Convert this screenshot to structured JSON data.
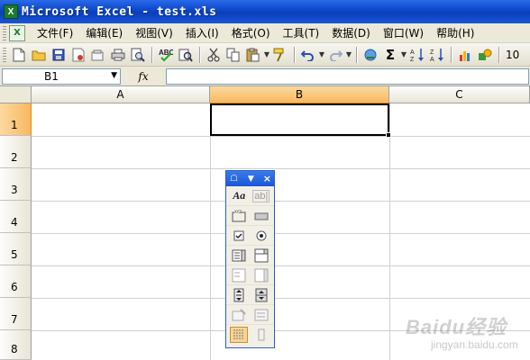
{
  "window": {
    "title": "Microsoft Excel - test.xls",
    "app_icon": "excel-icon"
  },
  "menu": {
    "items": [
      "文件(F)",
      "编辑(E)",
      "视图(V)",
      "插入(I)",
      "格式(O)",
      "工具(T)",
      "数据(D)",
      "窗口(W)",
      "帮助(H)"
    ]
  },
  "toolbar": {
    "font_size": "10",
    "icons": [
      "new-icon",
      "open-icon",
      "save-icon",
      "permission-icon",
      "email-icon",
      "print-icon",
      "print-preview-icon",
      "spelling-icon",
      "research-icon",
      "cut-icon",
      "copy-icon",
      "paste-icon",
      "format-painter-icon",
      "undo-icon",
      "redo-icon",
      "hyperlink-icon",
      "autosum-icon",
      "sort-ascending-icon",
      "sort-descending-icon",
      "chart-wizard-icon",
      "drawing-icon"
    ]
  },
  "formula_bar": {
    "name_box": "B1",
    "fx_label": "fx",
    "formula": ""
  },
  "sheet": {
    "columns": [
      "A",
      "B",
      "C"
    ],
    "rows": [
      "1",
      "2",
      "3",
      "4",
      "5",
      "6",
      "7",
      "8"
    ],
    "selected_column": "B",
    "selected_row": "1",
    "active_cell": "B1"
  },
  "forms_toolbar": {
    "title_icons": [
      "toolbar-options-icon",
      "close-icon"
    ],
    "buttons": [
      [
        "label-icon",
        "edit-box-icon"
      ],
      [
        "group-box-icon",
        "button-icon"
      ],
      [
        "checkbox-icon",
        "option-button-icon"
      ],
      [
        "list-box-icon",
        "combo-box-icon"
      ],
      [
        "combo-list-edit-icon",
        "combo-dropdown-edit-icon"
      ],
      [
        "scroll-bar-icon",
        "spinner-icon"
      ],
      [
        "control-properties-icon",
        "edit-code-icon"
      ],
      [
        "toggle-grid-icon",
        "run-dialog-icon"
      ]
    ]
  },
  "watermark": {
    "line1": "Baidu经验",
    "line2": "jingyan.baidu.com"
  }
}
